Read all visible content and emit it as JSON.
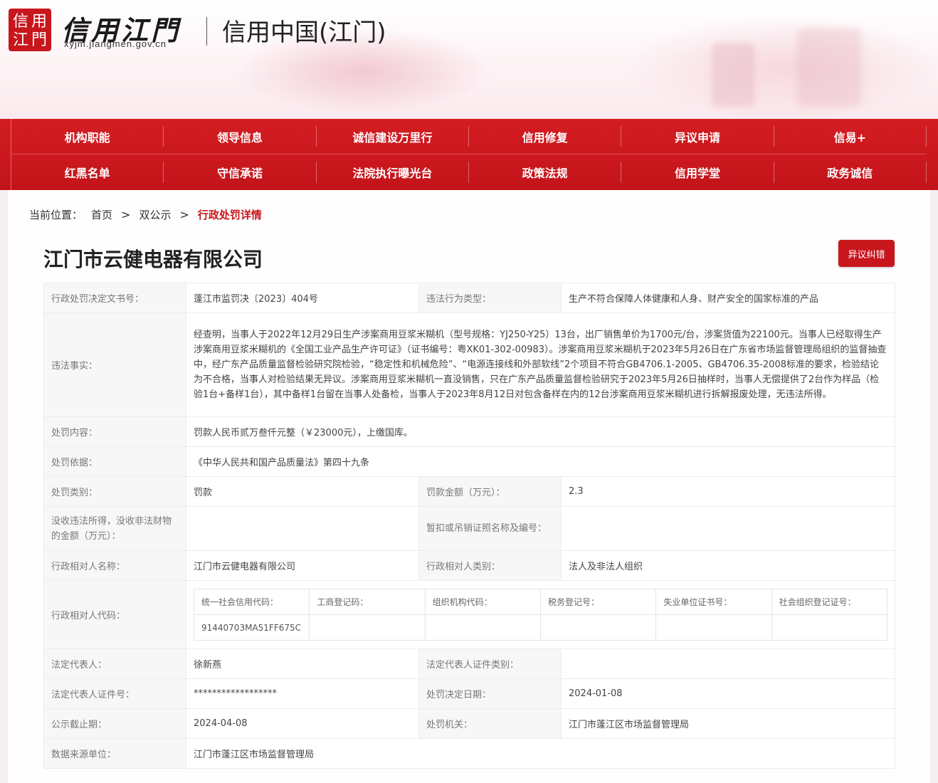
{
  "site": {
    "seal_text": "信用江門",
    "logo_name": "信用江門",
    "domain": "xyjm.jiangmen.gov.cn",
    "title": "信用中国(江门)"
  },
  "nav": {
    "row1": [
      "机构职能",
      "领导信息",
      "诚信建设万里行",
      "信用修复",
      "异议申请",
      "信易+"
    ],
    "row2": [
      "红黑名单",
      "守信承诺",
      "法院执行曝光台",
      "政策法规",
      "信用学堂",
      "政务诚信"
    ]
  },
  "breadcrumb": {
    "label": "当前位置：",
    "home": "首页",
    "sep": ">",
    "section": "双公示",
    "current": "行政处罚详情"
  },
  "company": "江门市云健电器有限公司",
  "objection_button": "异议纠错",
  "fields": {
    "doc_no_label": "行政处罚决定文书号：",
    "doc_no": "蓬江市监罚决〔2023〕404号",
    "violation_type_label": "违法行为类型：",
    "violation_type": "生产不符合保障人体健康和人身、财产安全的国家标准的产品",
    "facts_label": "违法事实：",
    "facts": "经查明，当事人于2022年12月29日生产涉案商用豆浆米糊机（型号规格：YJ250-Y25）13台，出厂销售单价为1700元/台，涉案货值为22100元。当事人已经取得生产涉案商用豆浆米糊机的《全国工业产品生产许可证》（证书编号：粤XK01-302-00983）。涉案商用豆浆米糊机于2023年5月26日在广东省市场监督管理局组织的监督抽查中，经广东产品质量监督检验研究院检验，“稳定性和机械危险”、“电源连接线和外部软线”2个项目不符合GB4706.1-2005、GB4706.35-2008标准的要求，检验结论为不合格，当事人对检验结果无异议。涉案商用豆浆米糊机一直没销售，只在广东产品质量监督检验研究于2023年5月26日抽样时，当事人无偿提供了2台作为样品（检验1台+备样1台），其中备样1台留在当事人处备检，当事人于2023年8月12日对包含备样在内的12台涉案商用豆浆米糊机进行拆解报废处理，无违法所得。",
    "content_label": "处罚内容：",
    "content": "罚款人民币贰万叁仟元整（￥23000元），上缴国库。",
    "basis_label": "处罚依据：",
    "basis": "《中华人民共和国产品质量法》第四十九条",
    "category_label": "处罚类别：",
    "category": "罚款",
    "fine_label": "罚款金额（万元）：",
    "fine": "2.3",
    "confiscate_label": "没收违法所得，没收非法财物的金额（万元）：",
    "confiscate": "",
    "license_label": "暂扣或吊销证照名称及编号：",
    "license": "",
    "party_name_label": "行政相对人名称：",
    "party_name": "江门市云健电器有限公司",
    "party_type_label": "行政相对人类别：",
    "party_type": "法人及非法人组织",
    "party_code_label": "行政相对人代码：",
    "legal_rep_label": "法定代表人：",
    "legal_rep": "徐新燕",
    "legal_id_type_label": "法定代表人证件类别：",
    "legal_id_type": "",
    "legal_id_no_label": "法定代表人证件号：",
    "legal_id_no": "******************",
    "decision_date_label": "处罚决定日期：",
    "decision_date": "2024-01-08",
    "deadline_label": "公示截止期：",
    "deadline": "2024-04-08",
    "authority_label": "处罚机关：",
    "authority": "江门市蓬江区市场监督管理局",
    "source_label": "数据来源单位：",
    "source": "江门市蓬江区市场监督管理局"
  },
  "codes": {
    "headers": [
      "统一社会信用代码：",
      "工商登记码：",
      "组织机构代码：",
      "税务登记号：",
      "失业单位证书号：",
      "社会组织登记证号："
    ],
    "values": [
      "91440703MA51FF675C",
      "",
      "",
      "",
      "",
      ""
    ]
  }
}
